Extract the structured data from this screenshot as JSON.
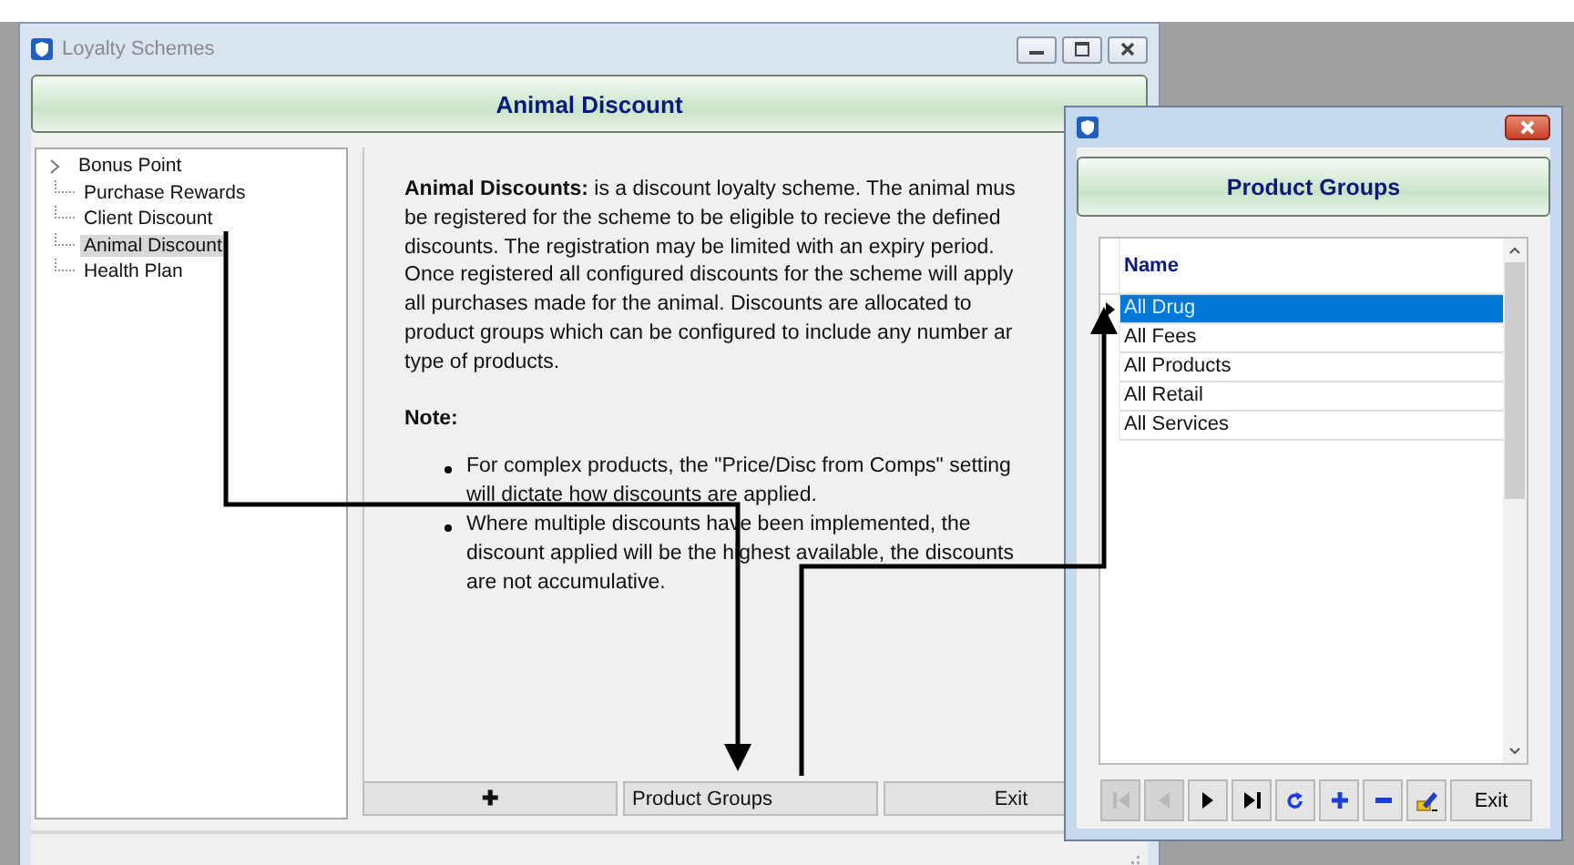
{
  "main_window": {
    "title": "Loyalty Schemes",
    "header": "Animal Discount"
  },
  "tree": [
    {
      "label": "Bonus Point",
      "has_children": true,
      "selected": false
    },
    {
      "label": "Purchase Rewards",
      "has_children": false,
      "selected": false
    },
    {
      "label": "Client Discount",
      "has_children": false,
      "selected": false
    },
    {
      "label": "Animal Discount",
      "has_children": false,
      "selected": true
    },
    {
      "label": "Health Plan",
      "has_children": false,
      "selected": false
    }
  ],
  "description": {
    "lines": [
      "**Animal Discounts:** is a discount loyalty scheme. The animal mus",
      "be registered for the scheme to be eligible to recieve the defined",
      "discounts. The registration may be limited with an expiry period.",
      "Once registered all configured discounts for the scheme will apply",
      "all purchases made for the animal. Discounts are allocated to",
      "product groups which can be configured to include any number ar",
      "type of products."
    ],
    "note_heading": "Note:",
    "bullets": [
      [
        "For complex products, the \"Price/Disc from Comps\" setting",
        "will dictate how discounts are applied."
      ],
      [
        "Where multiple discounts have been implemented, the",
        "discount applied will be the highest available, the discounts",
        "are not accumulative."
      ]
    ]
  },
  "buttons": [
    "✚",
    "Product Groups",
    "Exit"
  ],
  "dialog": {
    "header": "Product Groups",
    "column": "Name",
    "rows": [
      {
        "name": "All Drug",
        "selected": true
      },
      {
        "name": "All Fees",
        "selected": false
      },
      {
        "name": "All Products",
        "selected": false
      },
      {
        "name": "All Retail",
        "selected": false
      },
      {
        "name": "All Services",
        "selected": false
      }
    ],
    "nav_buttons": [
      {
        "kind": "first",
        "disabled": true
      },
      {
        "kind": "prev",
        "disabled": true
      },
      {
        "kind": "next",
        "disabled": false
      },
      {
        "kind": "last",
        "disabled": false
      },
      {
        "kind": "refresh",
        "disabled": false
      },
      {
        "kind": "add",
        "disabled": false
      },
      {
        "kind": "remove",
        "disabled": false
      },
      {
        "kind": "edit",
        "disabled": false
      }
    ],
    "exit": "Exit"
  }
}
